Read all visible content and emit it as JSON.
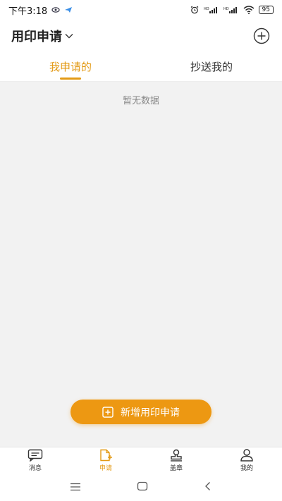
{
  "status_bar": {
    "time": "下午3:18",
    "battery": "95",
    "signal_label_1": "HD",
    "signal_label_2": "HD"
  },
  "header": {
    "title": "用印申请"
  },
  "tabs": [
    {
      "label": "我申请的",
      "active": true
    },
    {
      "label": "抄送我的",
      "active": false
    }
  ],
  "content": {
    "empty_text": "暂无数据",
    "new_button_label": "新增用印申请"
  },
  "bottom_nav": [
    {
      "label": "消息",
      "icon": "message-icon",
      "active": false
    },
    {
      "label": "申请",
      "icon": "apply-doc-icon",
      "active": true
    },
    {
      "label": "盖章",
      "icon": "stamp-icon",
      "active": false
    },
    {
      "label": "我的",
      "icon": "user-icon",
      "active": false
    }
  ],
  "colors": {
    "accent": "#e39a15",
    "button": "#ed9812",
    "content_bg": "#f2f2f2"
  }
}
